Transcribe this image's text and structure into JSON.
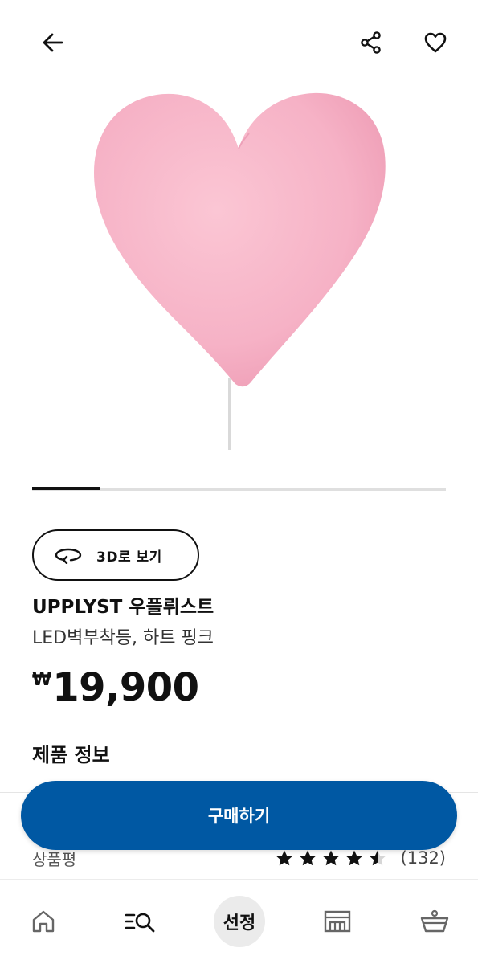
{
  "header": {
    "back_icon": "arrow-left-icon",
    "share_icon": "share-icon",
    "favorite_icon": "heart-outline-icon"
  },
  "gallery": {
    "image": "pink heart wall lamp",
    "progress": 0.166
  },
  "view3d": {
    "label": "3D로 보기",
    "icon": "rotate-3d-icon"
  },
  "product": {
    "name": "UPPLYST 우플뤼스트",
    "description": "LED벽부착등, 하트 핑크",
    "currency": "₩",
    "price": "19,900"
  },
  "sections": {
    "product_info": "제품 정보"
  },
  "reviews": {
    "label": "상품평",
    "rating": 4.5,
    "max": 5,
    "count": "(132)"
  },
  "cta": {
    "buy_label": "구매하기"
  },
  "bottom_nav": {
    "home_icon": "home-icon",
    "search_icon": "search-list-icon",
    "picks_label": "선정",
    "store_icon": "store-icon",
    "cart_icon": "basket-icon"
  },
  "colors": {
    "accent": "#0058a3",
    "heart": "#f7b6c8",
    "text": "#111111"
  }
}
